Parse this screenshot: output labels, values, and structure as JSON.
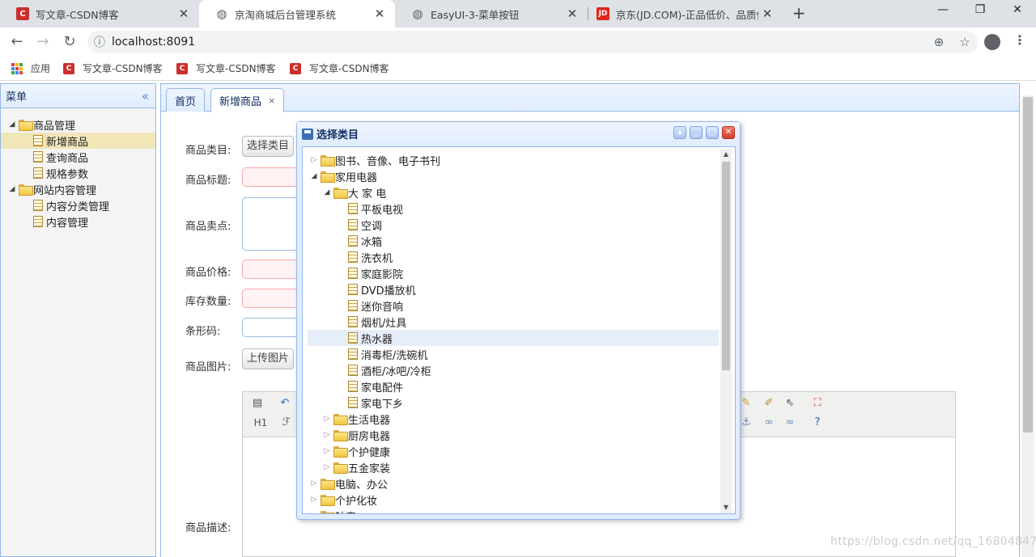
{
  "browser": {
    "tabs": [
      {
        "title": "写文章-CSDN博客",
        "favicon": "csdn-icon",
        "active": false
      },
      {
        "title": "京淘商城后台管理系统",
        "favicon": "globe-icon",
        "active": true
      },
      {
        "title": "EasyUI-3-菜单按钮",
        "favicon": "globe-icon",
        "active": false
      },
      {
        "title": "京东(JD.COM)-正品低价、品质保障",
        "favicon": "jd-icon",
        "active": false
      }
    ],
    "url": "localhost:8091",
    "bookmarks": [
      {
        "label": "应用",
        "icon": "apps-icon"
      },
      {
        "label": "写文章-CSDN博客",
        "icon": "csdn-icon"
      },
      {
        "label": "写文章-CSDN博客",
        "icon": "csdn-icon"
      },
      {
        "label": "写文章-CSDN博客",
        "icon": "csdn-icon"
      }
    ]
  },
  "west": {
    "title": "菜单",
    "tree": [
      {
        "label": "商品管理",
        "type": "folder",
        "expanded": true
      },
      {
        "label": "新增商品",
        "type": "file",
        "selected": true
      },
      {
        "label": "查询商品",
        "type": "file"
      },
      {
        "label": "规格参数",
        "type": "file"
      },
      {
        "label": "网站内容管理",
        "type": "folder",
        "expanded": true
      },
      {
        "label": "内容分类管理",
        "type": "file"
      },
      {
        "label": "内容管理",
        "type": "file"
      }
    ]
  },
  "center": {
    "tabs": [
      {
        "label": "首页",
        "closable": false
      },
      {
        "label": "新增商品",
        "closable": true,
        "close": "×"
      }
    ]
  },
  "form": {
    "category_label": "商品类目:",
    "category_button": "选择类目",
    "title_label": "商品标题:",
    "sell_point_label": "商品卖点:",
    "price_label": "商品价格:",
    "stock_label": "库存数量:",
    "barcode_label": "条形码:",
    "image_label": "商品图片:",
    "image_button": "上传图片",
    "desc_label": "商品描述:",
    "editor_h1": "H1"
  },
  "dialog": {
    "title": "选择类目",
    "tree": [
      {
        "label": "图书、音像、电子书刊",
        "type": "folder",
        "level": 0,
        "expanded": false
      },
      {
        "label": "家用电器",
        "type": "folder",
        "level": 0,
        "expanded": true
      },
      {
        "label": "大 家 电",
        "type": "folder",
        "level": 1,
        "expanded": true
      },
      {
        "label": "平板电视",
        "type": "file",
        "level": 2
      },
      {
        "label": "空调",
        "type": "file",
        "level": 2
      },
      {
        "label": "冰箱",
        "type": "file",
        "level": 2
      },
      {
        "label": "洗衣机",
        "type": "file",
        "level": 2
      },
      {
        "label": "家庭影院",
        "type": "file",
        "level": 2
      },
      {
        "label": "DVD播放机",
        "type": "file",
        "level": 2
      },
      {
        "label": "迷你音响",
        "type": "file",
        "level": 2
      },
      {
        "label": "烟机/灶具",
        "type": "file",
        "level": 2
      },
      {
        "label": "热水器",
        "type": "file",
        "level": 2,
        "hover": true
      },
      {
        "label": "消毒柜/洗碗机",
        "type": "file",
        "level": 2
      },
      {
        "label": "酒柜/冰吧/冷柜",
        "type": "file",
        "level": 2
      },
      {
        "label": "家电配件",
        "type": "file",
        "level": 2
      },
      {
        "label": "家电下乡",
        "type": "file",
        "level": 2
      },
      {
        "label": "生活电器",
        "type": "folder",
        "level": 1,
        "expanded": false
      },
      {
        "label": "厨房电器",
        "type": "folder",
        "level": 1,
        "expanded": false
      },
      {
        "label": "个护健康",
        "type": "folder",
        "level": 1,
        "expanded": false
      },
      {
        "label": "五金家装",
        "type": "folder",
        "level": 1,
        "expanded": false
      },
      {
        "label": "电脑、办公",
        "type": "folder",
        "level": 0,
        "expanded": false
      },
      {
        "label": "个护化妆",
        "type": "folder",
        "level": 0,
        "expanded": false
      },
      {
        "label": "钟表",
        "type": "folder",
        "level": 0,
        "expanded": false
      }
    ]
  },
  "watermark": "https://blog.csdn.net/qq_16804847"
}
